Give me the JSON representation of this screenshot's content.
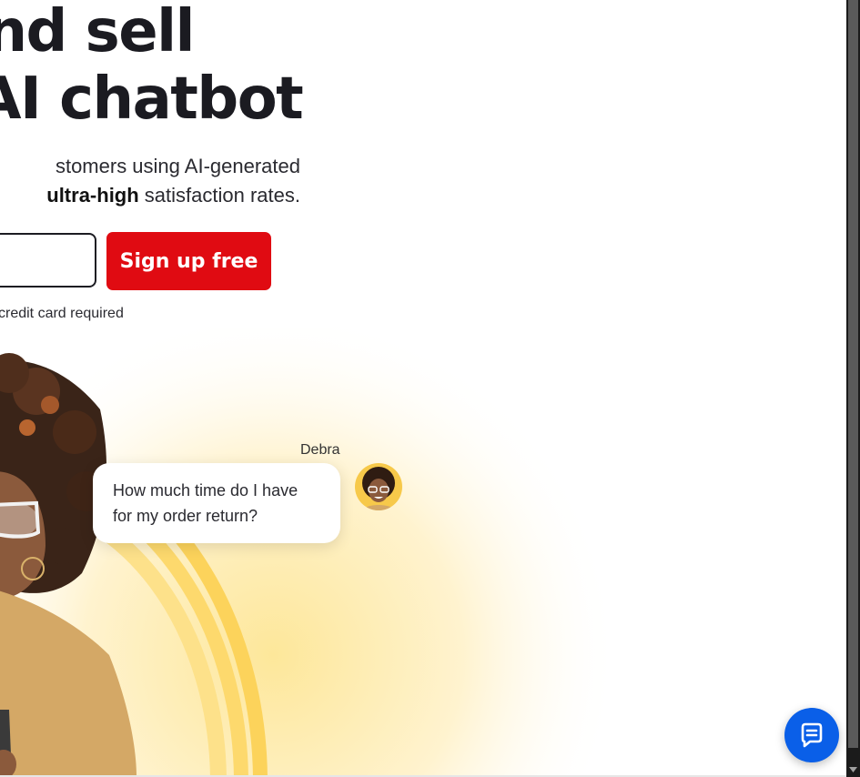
{
  "hero": {
    "title_line1": "rt, and sell",
    "title_line2": "ven AI chatbot",
    "subtitle_line1": "stomers using AI-generated",
    "subtitle_bold": "ultra-high",
    "subtitle_rest": " satisfaction rates."
  },
  "signup": {
    "email_value": "",
    "email_placeholder": "",
    "button_label": "Sign up free",
    "note": "credit card required"
  },
  "chat_preview": {
    "agent_name": "Debra",
    "message_line1": "How much time do I have",
    "message_line2": "for my order return?"
  },
  "colors": {
    "accent": "#e00b12",
    "launcher": "#0a5fe8",
    "arc": "#fcd35b"
  },
  "icons": {
    "launcher": "chat-bubble-icon",
    "scroll_down": "triangle-down-icon"
  }
}
